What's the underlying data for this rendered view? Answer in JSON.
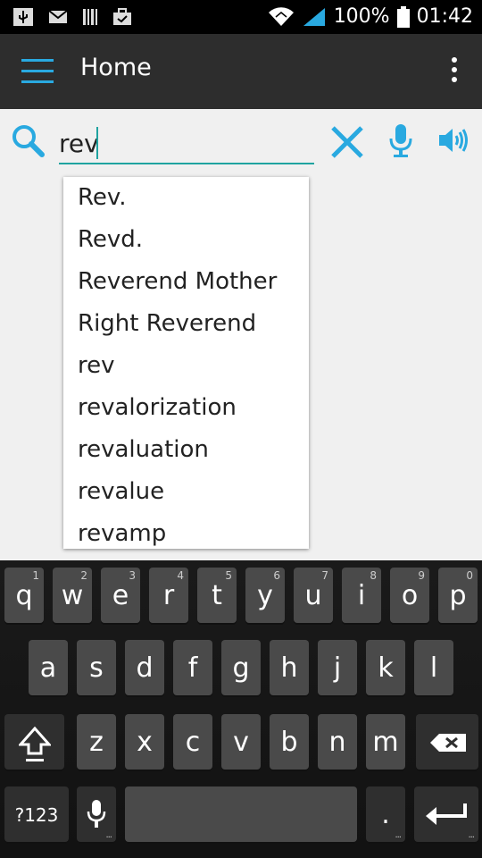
{
  "status_bar": {
    "battery_percent": "100%",
    "time": "01:42",
    "icons": [
      "usb-icon",
      "mail-icon",
      "barcode-icon",
      "briefcase-icon",
      "wifi-icon",
      "signal-icon",
      "battery-icon"
    ]
  },
  "app_bar": {
    "title": "Home",
    "menu_icon": "hamburger-menu-icon",
    "overflow_icon": "more-vert-icon",
    "accent_color": "#29a9e0"
  },
  "search": {
    "value": "rev",
    "underline_color": "#1fa3a0",
    "icons": [
      "search-icon",
      "clear-icon",
      "microphone-icon",
      "speaker-icon"
    ]
  },
  "suggestions": [
    "Rev.",
    "Revd.",
    "Reverend Mother",
    "Right Reverend",
    "rev",
    "revalorization",
    "revaluation",
    "revalue",
    "revamp"
  ],
  "keyboard": {
    "row1": [
      {
        "label": "q",
        "hint": "1"
      },
      {
        "label": "w",
        "hint": "2"
      },
      {
        "label": "e",
        "hint": "3"
      },
      {
        "label": "r",
        "hint": "4"
      },
      {
        "label": "t",
        "hint": "5"
      },
      {
        "label": "y",
        "hint": "6"
      },
      {
        "label": "u",
        "hint": "7"
      },
      {
        "label": "i",
        "hint": "8"
      },
      {
        "label": "o",
        "hint": "9"
      },
      {
        "label": "p",
        "hint": "0"
      }
    ],
    "row2": [
      "a",
      "s",
      "d",
      "f",
      "g",
      "h",
      "j",
      "k",
      "l"
    ],
    "row3": [
      "z",
      "x",
      "c",
      "v",
      "b",
      "n",
      "m"
    ],
    "symbols_label": "?123",
    "period_label": ".",
    "dots": "..."
  }
}
